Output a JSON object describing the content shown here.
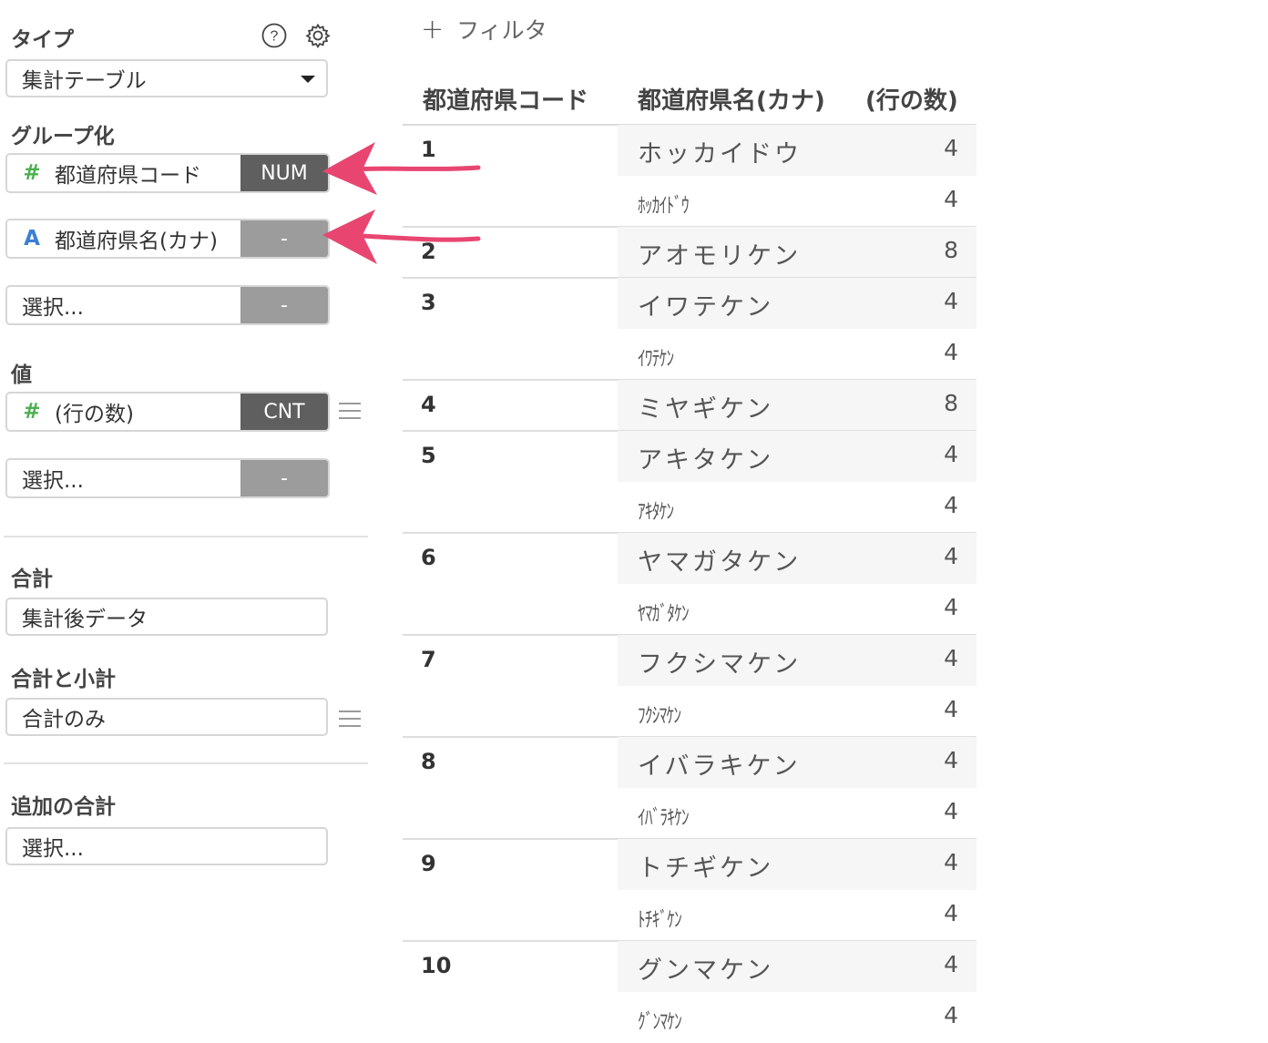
{
  "left": {
    "type_label": "タイプ",
    "type_value": "集計テーブル",
    "group_label": "グループ化",
    "group_fields": [
      {
        "tag": "#",
        "name": "都道府県コード",
        "agg": "NUM"
      },
      {
        "tag": "A",
        "name": "都道府県名(カナ)",
        "agg": "-"
      },
      {
        "tag": "",
        "name": "選択...",
        "agg": "-"
      }
    ],
    "value_label": "値",
    "value_fields": [
      {
        "tag": "#",
        "name": "(行の数)",
        "agg": "CNT"
      },
      {
        "tag": "",
        "name": "選択...",
        "agg": "-"
      }
    ],
    "total_label": "合計",
    "total_value": "集計後データ",
    "subtotal_label": "合計と小計",
    "subtotal_value": "合計のみ",
    "extra_label": "追加の合計",
    "extra_value": "選択..."
  },
  "main": {
    "filter_label": "フィルタ",
    "columns": [
      "都道府県コード",
      "都道府県名(カナ)",
      "(行の数)"
    ],
    "groups": [
      {
        "code": "1",
        "rows": [
          {
            "name": "ホッカイドウ",
            "count": "4"
          },
          {
            "name": "ﾎｯｶｲﾄﾞｳ",
            "count": "4"
          }
        ]
      },
      {
        "code": "2",
        "rows": [
          {
            "name": "アオモリケン",
            "count": "8"
          }
        ]
      },
      {
        "code": "3",
        "rows": [
          {
            "name": "イワテケン",
            "count": "4"
          },
          {
            "name": "ｲﾜﾃｹﾝ",
            "count": "4"
          }
        ]
      },
      {
        "code": "4",
        "rows": [
          {
            "name": "ミヤギケン",
            "count": "8"
          }
        ]
      },
      {
        "code": "5",
        "rows": [
          {
            "name": "アキタケン",
            "count": "4"
          },
          {
            "name": "ｱｷﾀｹﾝ",
            "count": "4"
          }
        ]
      },
      {
        "code": "6",
        "rows": [
          {
            "name": "ヤマガタケン",
            "count": "4"
          },
          {
            "name": "ﾔﾏｶﾞﾀｹﾝ",
            "count": "4"
          }
        ]
      },
      {
        "code": "7",
        "rows": [
          {
            "name": "フクシマケン",
            "count": "4"
          },
          {
            "name": "ﾌｸｼﾏｹﾝ",
            "count": "4"
          }
        ]
      },
      {
        "code": "8",
        "rows": [
          {
            "name": "イバラキケン",
            "count": "4"
          },
          {
            "name": "ｲﾊﾞﾗｷｹﾝ",
            "count": "4"
          }
        ]
      },
      {
        "code": "9",
        "rows": [
          {
            "name": "トチギケン",
            "count": "4"
          },
          {
            "name": "ﾄﾁｷﾞｹﾝ",
            "count": "4"
          }
        ]
      },
      {
        "code": "10",
        "rows": [
          {
            "name": "グンマケン",
            "count": "4"
          },
          {
            "name": "ｸﾞﾝﾏｹﾝ",
            "count": "4"
          }
        ]
      }
    ]
  },
  "colors": {
    "accent_arrow": "#e84670",
    "number_tag": "#4caf50",
    "text_tag": "#3a7fd5",
    "agg_dark": "#5f5f5f",
    "agg_light": "#9c9c9c"
  }
}
